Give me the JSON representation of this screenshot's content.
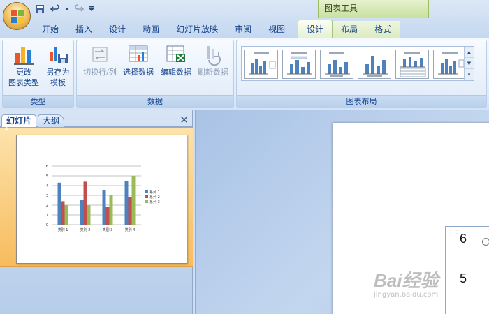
{
  "context_tool_title": "图表工具",
  "tabs": [
    {
      "label": "开始"
    },
    {
      "label": "插入"
    },
    {
      "label": "设计"
    },
    {
      "label": "动画"
    },
    {
      "label": "幻灯片放映"
    },
    {
      "label": "审阅"
    },
    {
      "label": "视图"
    },
    {
      "label": "设计",
      "active": true
    },
    {
      "label": "布局"
    },
    {
      "label": "格式"
    }
  ],
  "ribbon": {
    "type_group": {
      "label": "类型",
      "change_chart_type": "更改\n图表类型",
      "save_as_template": "另存为\n模板"
    },
    "data_group": {
      "label": "数据",
      "switch_row_col": "切换行/列",
      "select_data": "选择数据",
      "edit_data": "编辑数据",
      "refresh_data": "刷新数据"
    },
    "layout_group": {
      "label": "图表布局"
    }
  },
  "slide_pane": {
    "tab_slides": "幻灯片",
    "tab_outline": "大纲",
    "close": "✕",
    "slide_number": "1"
  },
  "thumbnail_chart": {
    "type": "bar",
    "categories": [
      "类别 1",
      "类别 2",
      "类别 3",
      "类别 4"
    ],
    "series": [
      {
        "name": "系列 1",
        "values": [
          4.3,
          2.5,
          3.5,
          4.5
        ],
        "color": "#4f81bd"
      },
      {
        "name": "系列 2",
        "values": [
          2.4,
          4.4,
          1.8,
          2.8
        ],
        "color": "#c0504d"
      },
      {
        "name": "系列 3",
        "values": [
          2,
          2,
          3,
          5
        ],
        "color": "#9bbb59"
      }
    ],
    "ylim": [
      0,
      6
    ],
    "yticks": [
      "0",
      "1",
      "2",
      "3",
      "4",
      "5",
      "6"
    ]
  },
  "editor_chart": {
    "tick_6": "6",
    "tick_5": "5"
  },
  "watermark": {
    "text": "Bai经验",
    "url": "jingyan.baidu.com"
  }
}
